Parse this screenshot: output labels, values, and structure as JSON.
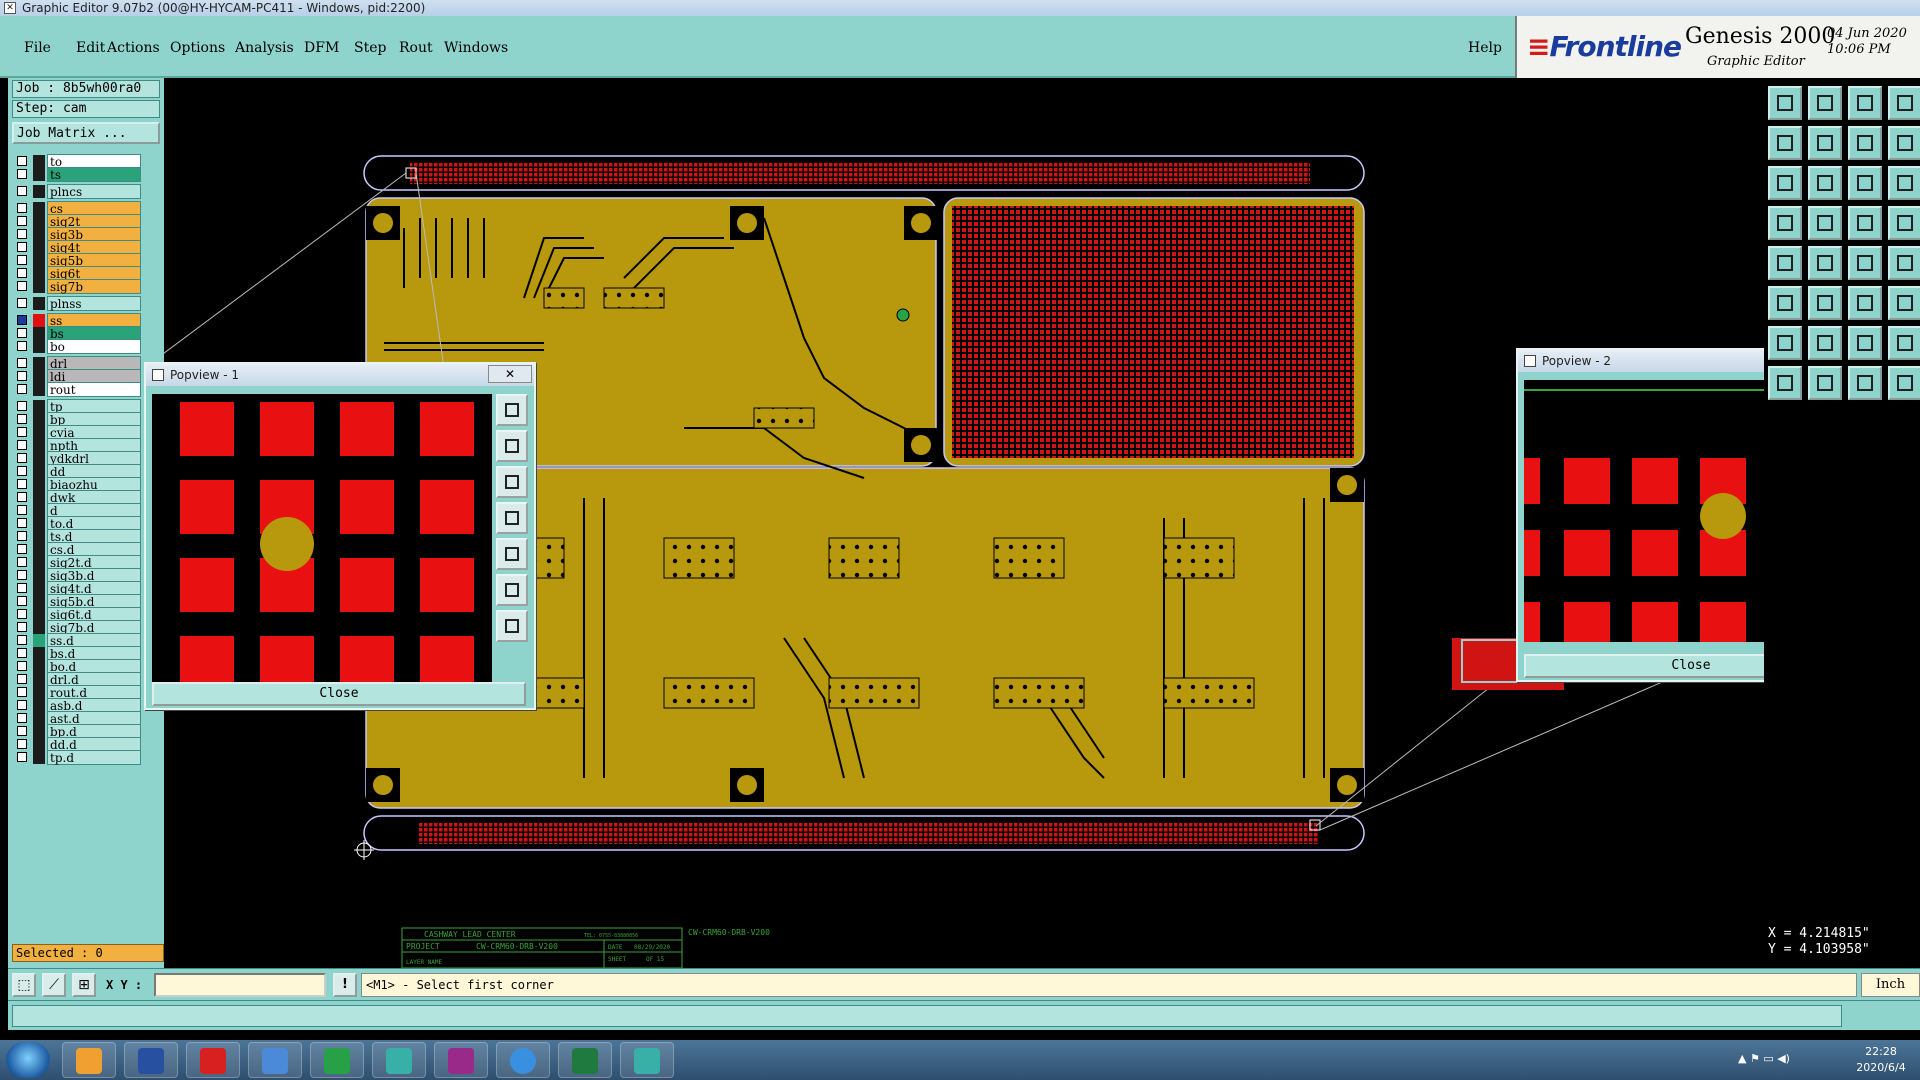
{
  "window": {
    "title": "Graphic Editor 9.07b2 (00@HY-HYCAM-PC411 - Windows, pid:2200)"
  },
  "menu": {
    "items": [
      "File",
      "Edit",
      "Actions",
      "Options",
      "Analysis",
      "DFM",
      "Step",
      "Rout",
      "Windows"
    ],
    "help": "Help"
  },
  "logo": {
    "brand": "Frontline",
    "product": "Genesis 2000",
    "subtitle": "Graphic Editor",
    "date": "04 Jun 2020",
    "time": "10:06 PM"
  },
  "job": {
    "job_label": "Job : 8b5wh00ra0",
    "step_label": "Step: cam",
    "matrix_button": "Job Matrix ..."
  },
  "layers": [
    {
      "name": "to",
      "bg": "#ffffff",
      "arrow": true
    },
    {
      "name": "ts",
      "bg": "#2aa27a",
      "arrow": false
    },
    {
      "name": "plncs",
      "bg": "#b4e4de",
      "arrow": false,
      "gap": true
    },
    {
      "name": "cs",
      "bg": "#f2b040",
      "arrow": true,
      "gap": true
    },
    {
      "name": "sig2t",
      "bg": "#f2b040",
      "arrow": true
    },
    {
      "name": "sig3b",
      "bg": "#f2b040",
      "arrow": true
    },
    {
      "name": "sig4t",
      "bg": "#f2b040",
      "arrow": true
    },
    {
      "name": "sig5b",
      "bg": "#f2b040",
      "arrow": true
    },
    {
      "name": "sig6t",
      "bg": "#f2b040",
      "arrow": true
    },
    {
      "name": "sig7b",
      "bg": "#f2b040",
      "arrow": true
    },
    {
      "name": "plnss",
      "bg": "#b4e4de",
      "arrow": false,
      "gap": true
    },
    {
      "name": "ss",
      "bg": "#f2b040",
      "arrow": true,
      "gap": true,
      "active": true,
      "swatch": "#e01010"
    },
    {
      "name": "bs",
      "bg": "#2aa27a",
      "arrow": false
    },
    {
      "name": "bo",
      "bg": "#ffffff",
      "arrow": false
    },
    {
      "name": "drl",
      "bg": "#b8b8b8",
      "arrow": false,
      "gap": true
    },
    {
      "name": "ldi",
      "bg": "#b8b8b8",
      "arrow": false
    },
    {
      "name": "rout",
      "bg": "#ffffff",
      "arrow": false
    },
    {
      "name": "tp",
      "bg": "#b4e4de",
      "arrow": false,
      "gap": true
    },
    {
      "name": "bp",
      "bg": "#b4e4de",
      "arrow": false
    },
    {
      "name": "cvia",
      "bg": "#b4e4de",
      "arrow": false
    },
    {
      "name": "npth",
      "bg": "#b4e4de",
      "arrow": false
    },
    {
      "name": "ydkdrl",
      "bg": "#b4e4de",
      "arrow": false
    },
    {
      "name": "dd",
      "bg": "#b4e4de",
      "arrow": false
    },
    {
      "name": "biaozhu",
      "bg": "#b4e4de",
      "arrow": false
    },
    {
      "name": "dwk",
      "bg": "#b4e4de",
      "arrow": false
    },
    {
      "name": "d",
      "bg": "#b4e4de",
      "arrow": false
    },
    {
      "name": "to.d",
      "bg": "#b4e4de",
      "arrow": true
    },
    {
      "name": "ts.d",
      "bg": "#b4e4de",
      "arrow": false
    },
    {
      "name": "cs.d",
      "bg": "#b4e4de",
      "arrow": true
    },
    {
      "name": "sig2t.d",
      "bg": "#b4e4de",
      "arrow": true
    },
    {
      "name": "sig3b.d",
      "bg": "#b4e4de",
      "arrow": true
    },
    {
      "name": "sig4t.d",
      "bg": "#b4e4de",
      "arrow": true
    },
    {
      "name": "sig5b.d",
      "bg": "#b4e4de",
      "arrow": true
    },
    {
      "name": "sig6t.d",
      "bg": "#b4e4de",
      "arrow": true
    },
    {
      "name": "sig7b.d",
      "bg": "#b4e4de",
      "arrow": true
    },
    {
      "name": "ss.d",
      "bg": "#b4e4de",
      "arrow": true,
      "swatch": "#2aa27a"
    },
    {
      "name": "bs.d",
      "bg": "#b4e4de",
      "arrow": false
    },
    {
      "name": "bo.d",
      "bg": "#b4e4de",
      "arrow": false
    },
    {
      "name": "drl.d",
      "bg": "#b4e4de",
      "arrow": false
    },
    {
      "name": "rout.d",
      "bg": "#b4e4de",
      "arrow": false
    },
    {
      "name": "asb.d",
      "bg": "#b4e4de",
      "arrow": true
    },
    {
      "name": "ast.d",
      "bg": "#b4e4de",
      "arrow": true
    },
    {
      "name": "bp.d",
      "bg": "#b4e4de",
      "arrow": false
    },
    {
      "name": "dd.d",
      "bg": "#b4e4de",
      "arrow": false
    },
    {
      "name": "tp.d",
      "bg": "#b4e4de",
      "arrow": false
    }
  ],
  "selected": "Selected : 0",
  "bottom": {
    "xy_label": "X Y :",
    "xy_value": "",
    "warn": "!",
    "prompt": "<M1> - Select first corner",
    "units": "Inch"
  },
  "coords": {
    "x": "X = 4.214815\"",
    "y": "Y = 4.103958\""
  },
  "popview1": {
    "title": "Popview - 1",
    "close": "Close"
  },
  "popview2": {
    "title": "Popview - 2",
    "close": "Close"
  },
  "titleblock": {
    "header": "CASHWAY LEAD CENTER",
    "tel": "TEL: 0755-83880856",
    "project_label": "PROJECT",
    "project_value": "CW-CRM60-DRB-V200",
    "date_label": "DATE",
    "date_value": "08/29/2020",
    "sheet_label": "SHEET",
    "sheet_value": "OF 15",
    "layer_label": "LAYER NAME",
    "side_text": "CW-CRM60-DRB-V200"
  },
  "taskbar": {
    "time": "22:28",
    "date": "2020/6/4"
  },
  "colors": {
    "panel": "#8fd4cc",
    "copper": "#b8980c",
    "soldermask": "#e01010",
    "accent": "#1a3c9c"
  }
}
